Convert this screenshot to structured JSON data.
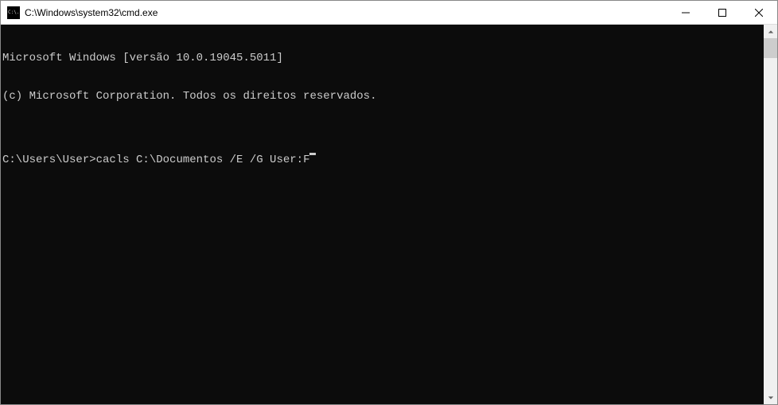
{
  "window": {
    "icon_text": "C:\\.",
    "title": "C:\\Windows\\system32\\cmd.exe"
  },
  "terminal": {
    "line1": "Microsoft Windows [versão 10.0.19045.5011]",
    "line2": "(c) Microsoft Corporation. Todos os direitos reservados.",
    "blank": "",
    "prompt": "C:\\Users\\User>",
    "command": "cacls C:\\Documentos /E /G User:F"
  }
}
